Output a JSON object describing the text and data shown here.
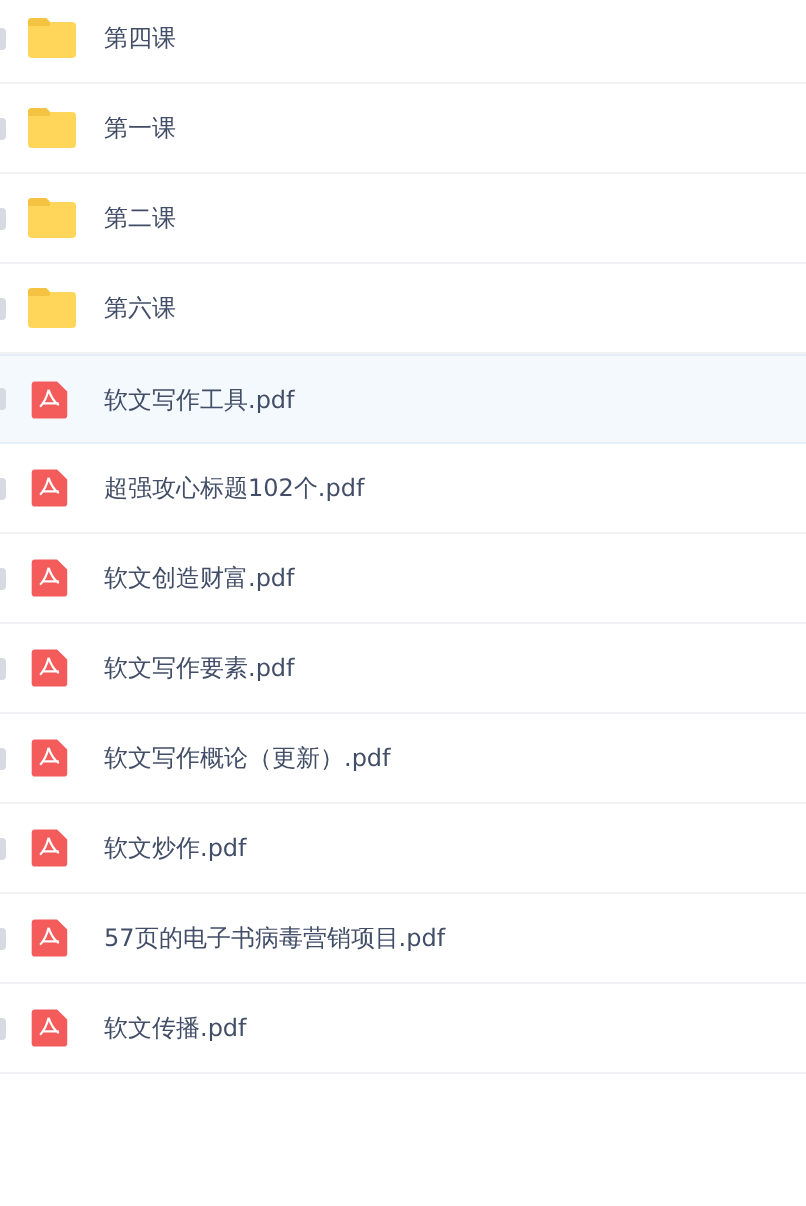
{
  "files": [
    {
      "kind": "folder",
      "name": "第四课",
      "selected": false
    },
    {
      "kind": "folder",
      "name": "第一课",
      "selected": false
    },
    {
      "kind": "folder",
      "name": "第二课",
      "selected": false
    },
    {
      "kind": "folder",
      "name": "第六课",
      "selected": false
    },
    {
      "kind": "pdf",
      "name": "软文写作工具.pdf",
      "selected": true
    },
    {
      "kind": "pdf",
      "name": "超强攻心标题102个.pdf",
      "selected": false
    },
    {
      "kind": "pdf",
      "name": "软文创造财富.pdf",
      "selected": false
    },
    {
      "kind": "pdf",
      "name": "软文写作要素.pdf",
      "selected": false
    },
    {
      "kind": "pdf",
      "name": "软文写作概论（更新）.pdf",
      "selected": false
    },
    {
      "kind": "pdf",
      "name": "软文炒作.pdf",
      "selected": false
    },
    {
      "kind": "pdf",
      "name": "57页的电子书病毒营销项目.pdf",
      "selected": false
    },
    {
      "kind": "pdf",
      "name": "软文传播.pdf",
      "selected": false
    }
  ]
}
